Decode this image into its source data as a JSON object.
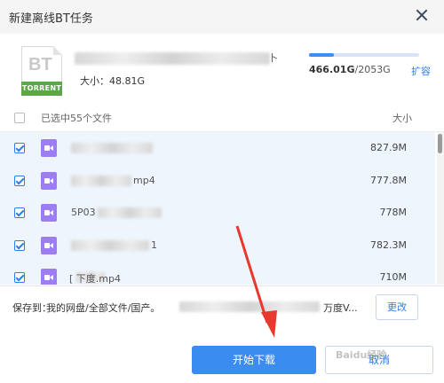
{
  "dialog": {
    "title": "新建离线BT任务"
  },
  "torrent": {
    "icon_text": "BT",
    "icon_band": "TORRENT",
    "file_name_tail": "卜",
    "size_text": "大小：48.81G"
  },
  "quota": {
    "used": "466.01G",
    "total": "/2053G",
    "used_fraction": 0.227,
    "expand_label": "扩容"
  },
  "list": {
    "select_all_label": "已选中55个文件",
    "size_header": "大小",
    "files": [
      {
        "name": "",
        "size": "827.9M"
      },
      {
        "name": "mp4",
        "size": "777.8M"
      },
      {
        "name": "5P03",
        "size": "778M"
      },
      {
        "name": "1",
        "size": "782.3M"
      },
      {
        "name": "[ 下度.mp4",
        "size": "710M"
      }
    ]
  },
  "save": {
    "label": "保存到：",
    "path": "我的网盘/全部文件/国产。",
    "path_tail": "万度V...",
    "change_label": "更改"
  },
  "actions": {
    "start_label": "开始下载",
    "cancel_label": "取消"
  },
  "watermark": "Baidu经验",
  "colors": {
    "accent": "#3b8cf0",
    "file_icon": "#9d7df2",
    "torrent_band": "#5aa846",
    "annotation_arrow": "#e8392e"
  }
}
